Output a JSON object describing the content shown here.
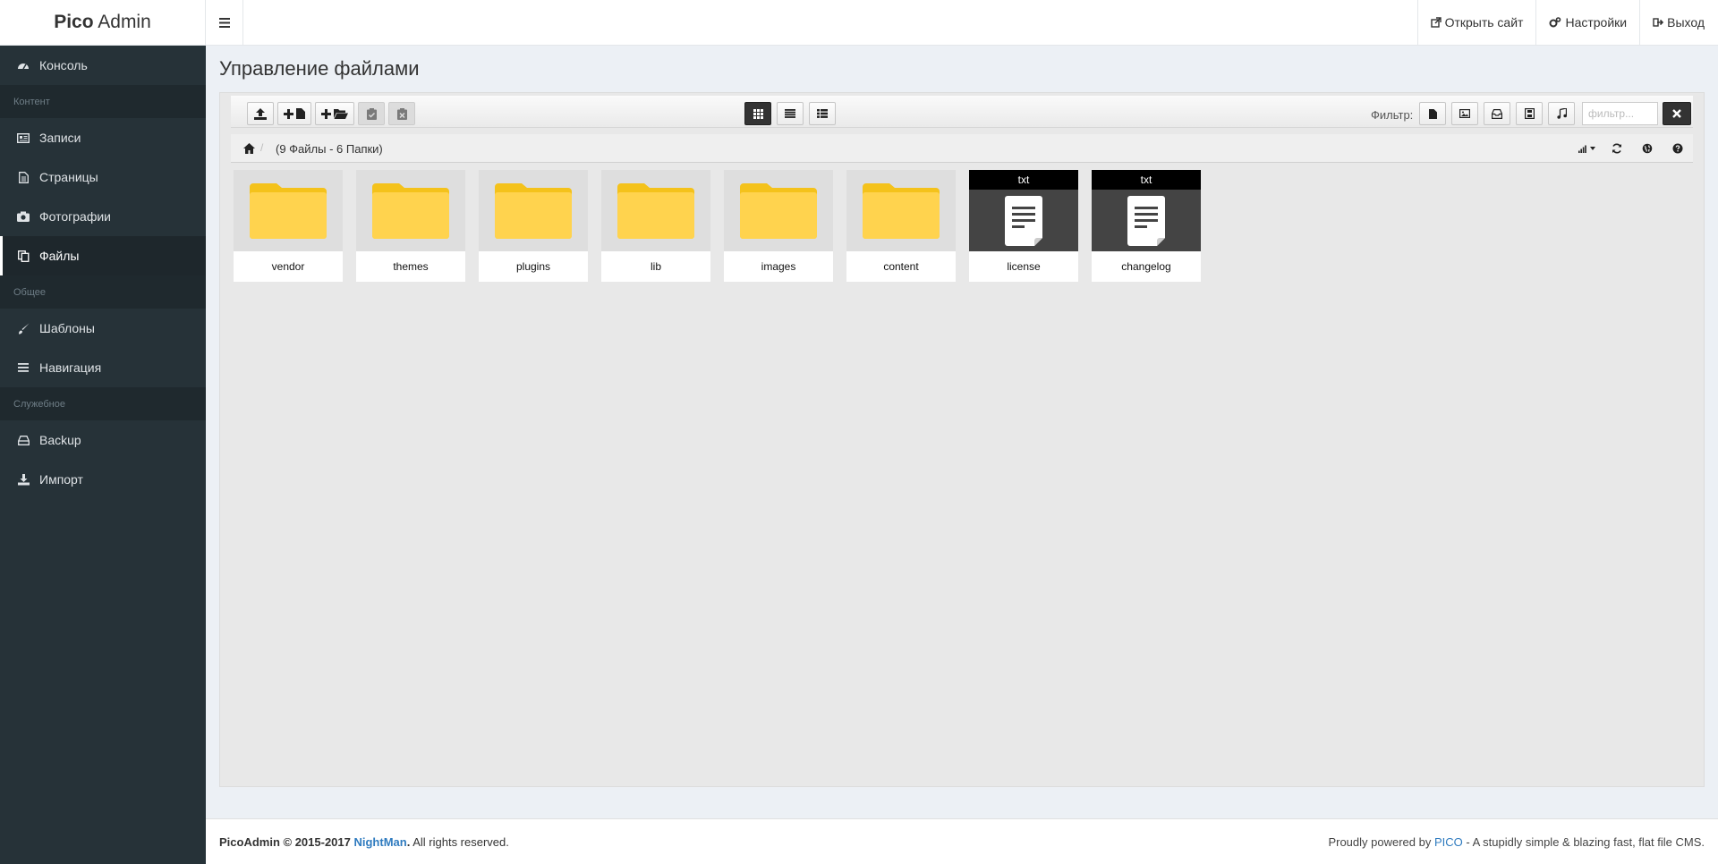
{
  "brand": {
    "bold": "Pico",
    "rest": " Admin"
  },
  "topnav": {
    "open_site": "Открыть сайт",
    "settings": "Настройки",
    "logout": "Выход"
  },
  "sidebar": {
    "items": [
      {
        "label": "Консоль",
        "icon": "dashboard-icon"
      },
      {
        "header": "Контент"
      },
      {
        "label": "Записи",
        "icon": "newspaper-icon"
      },
      {
        "label": "Страницы",
        "icon": "file-text-icon"
      },
      {
        "label": "Фотографии",
        "icon": "camera-icon"
      },
      {
        "label": "Файлы",
        "icon": "files-icon",
        "active": true
      },
      {
        "header": "Общее"
      },
      {
        "label": "Шаблоны",
        "icon": "brush-icon"
      },
      {
        "label": "Навигация",
        "icon": "list-icon"
      },
      {
        "header": "Служебное"
      },
      {
        "label": "Backup",
        "icon": "hdd-icon"
      },
      {
        "label": "Импорт",
        "icon": "download-icon"
      }
    ]
  },
  "page": {
    "title": "Управление файлами"
  },
  "toolbar": {
    "filter_label": "Фильтр:",
    "filter_placeholder": "фильтр..."
  },
  "breadcrumb": {
    "count": "(9 Файлы - 6 Папки)"
  },
  "files": [
    {
      "name": "vendor",
      "type": "folder"
    },
    {
      "name": "themes",
      "type": "folder"
    },
    {
      "name": "plugins",
      "type": "folder"
    },
    {
      "name": "lib",
      "type": "folder"
    },
    {
      "name": "images",
      "type": "folder"
    },
    {
      "name": "content",
      "type": "folder"
    },
    {
      "name": "license",
      "type": "file",
      "ext": "txt"
    },
    {
      "name": "changelog",
      "type": "file",
      "ext": "txt"
    }
  ],
  "footer": {
    "left_prefix": "PicoAdmin © 2015-2017 ",
    "left_link": "NightMan",
    "left_suffix": ". All rights reserved.",
    "right_prefix": "Proudly powered by ",
    "right_link": "PICO",
    "right_suffix": " - A stupidly simple & blazing fast, flat file CMS."
  },
  "colors": {
    "sidebar_bg": "#263238",
    "folder_yellow": "#ffd34e",
    "link": "#2f7bbf"
  }
}
